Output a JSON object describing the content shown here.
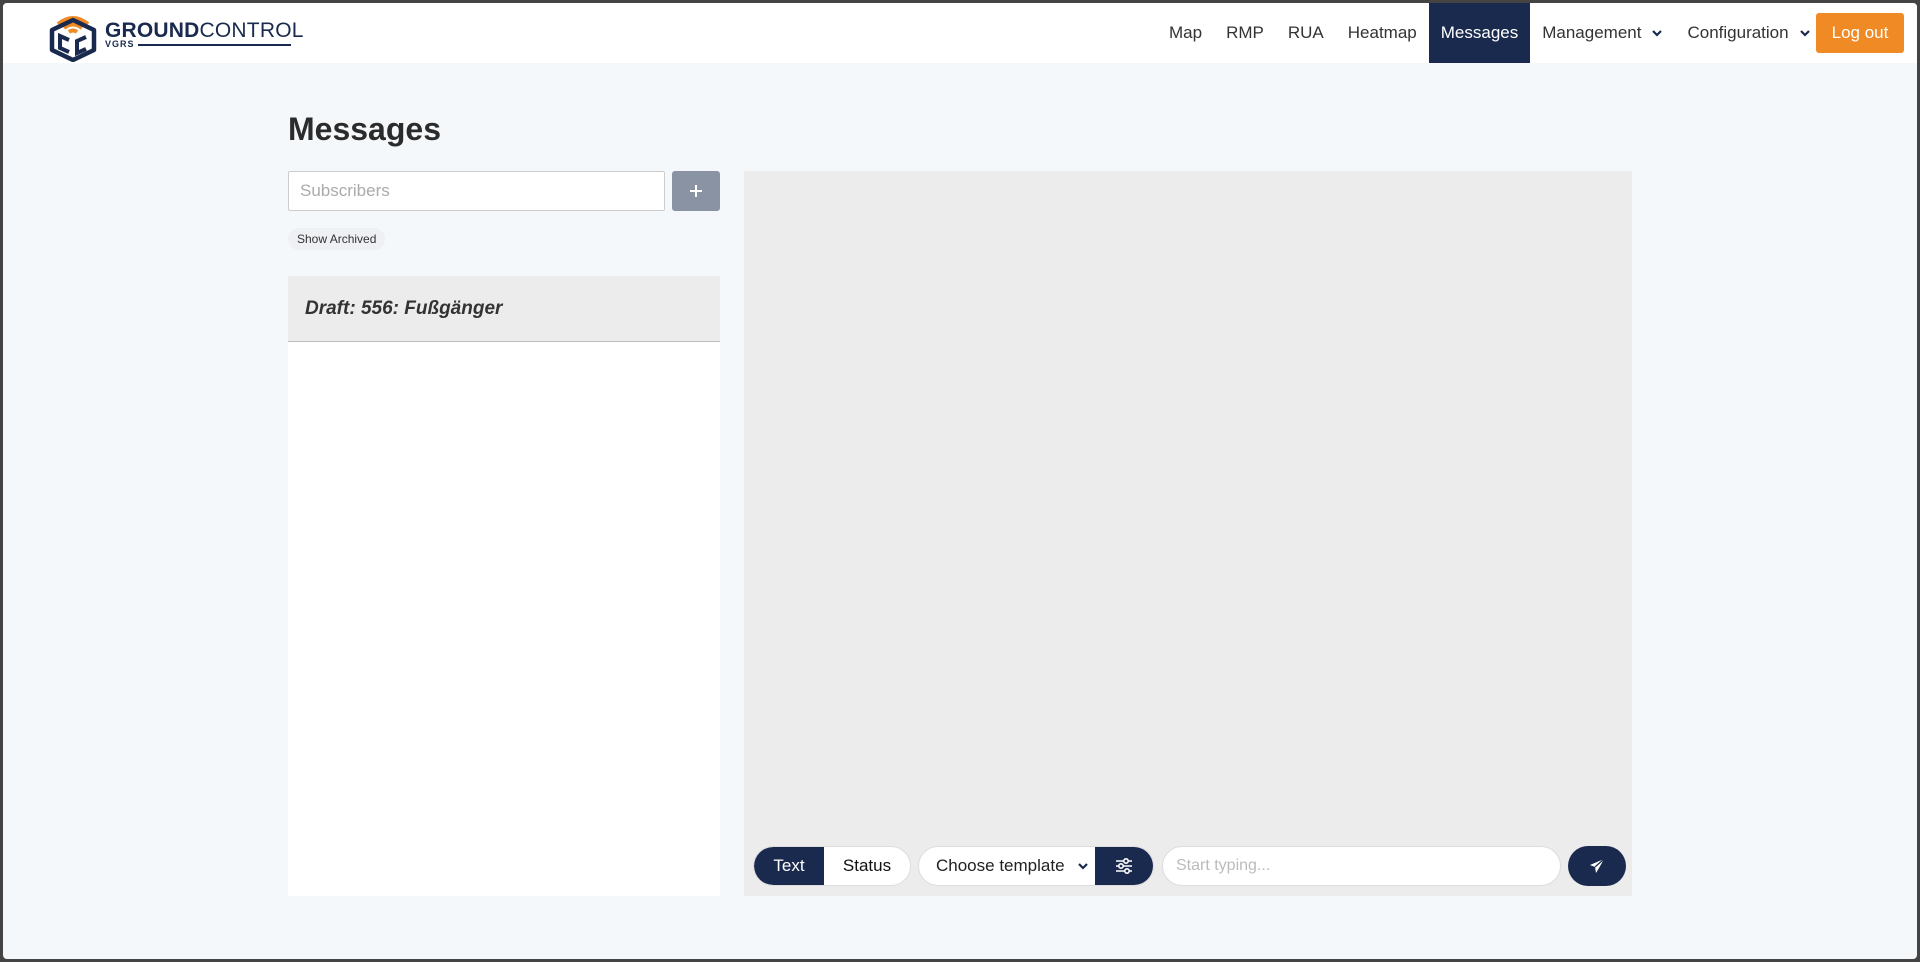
{
  "brand": {
    "name_bold": "GROUND",
    "name_light": "CONTROL",
    "tagline": "VGRS",
    "colors": {
      "navy": "#1a2a4e",
      "orange": "#f08a24"
    }
  },
  "nav": {
    "items": [
      {
        "label": "Map"
      },
      {
        "label": "RMP"
      },
      {
        "label": "RUA"
      },
      {
        "label": "Heatmap"
      },
      {
        "label": "Messages",
        "active": true
      },
      {
        "label": "Management",
        "dropdown": true
      },
      {
        "label": "Configuration",
        "dropdown": true
      }
    ],
    "logout_label": "Log out"
  },
  "page": {
    "title": "Messages",
    "subscribers_placeholder": "Subscribers",
    "add_icon": "plus-icon",
    "show_archived_label": "Show Archived",
    "conversations": [
      {
        "title": "Draft: 556: Fußgänger"
      }
    ]
  },
  "composer": {
    "mode_text_label": "Text",
    "mode_status_label": "Status",
    "template_label": "Choose template",
    "template_settings_icon": "sliders-icon",
    "message_placeholder": "Start typing...",
    "send_icon": "paper-plane-icon"
  }
}
